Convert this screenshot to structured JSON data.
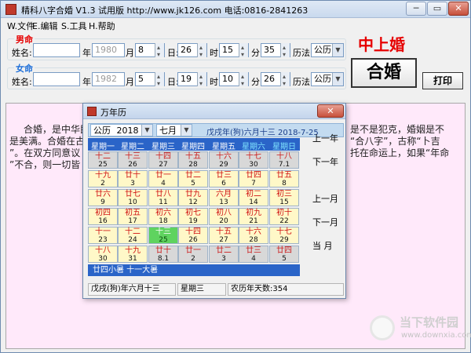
{
  "window": {
    "title": "精科八字合婚 V1.3  试用版 http://www.jk126.com  电话:0816-2841263",
    "min": "─",
    "max": "▭",
    "close": "✕"
  },
  "menu": [
    "W.文件",
    "E.编辑",
    "S.工具",
    "H.帮助"
  ],
  "male": {
    "group": "男命",
    "name_label": "姓名:",
    "name": "",
    "year_label": "年:",
    "year": "1980",
    "month_label": "月:",
    "month": "8",
    "day_label": "日:",
    "day": "26",
    "hour_label": "时:",
    "hour": "15",
    "minute_label": "分:",
    "minute": "35",
    "calendar_label": "历法:",
    "calendar": "公历"
  },
  "female": {
    "group": "女命",
    "name_label": "姓名:",
    "name": "",
    "year_label": "年:",
    "year": "1982",
    "month_label": "月:",
    "month": "5",
    "day_label": "日:",
    "day": "19",
    "hour_label": "时:",
    "hour": "10",
    "minute_label": "分:",
    "minute": "26",
    "calendar_label": "历法:",
    "calendar": "公历"
  },
  "result": "中上婚",
  "buttons": {
    "hehun": "合婚",
    "print": "打印"
  },
  "text": {
    "line1_left": "合婚，是中华民",
    "line1_right": "是不是犯克，婚姻是不",
    "line2_left": "是美满。合婚在古",
    "line2_right": "“合八字”，古称“卜吉",
    "line3_left": "”。在双方同意议",
    "line3_right": "托在命运上，如果“年命",
    "line4_left": "”不合，则一切皆"
  },
  "calendar": {
    "title": "万年历",
    "close": "✕",
    "mode": "公历",
    "year": "2018 年",
    "month": "七月",
    "info": "戊戌年(狗)六月十三  2018-7-25",
    "weekdays": [
      "星期一",
      "星期二",
      "星期三",
      "星期四",
      "星期五",
      "星期六",
      "星期日"
    ],
    "rows": [
      [
        [
          "十二",
          "25"
        ],
        [
          "十三",
          "26"
        ],
        [
          "十四",
          "27"
        ],
        [
          "十五",
          "28"
        ],
        [
          "十六",
          "29"
        ],
        [
          "十七",
          "30"
        ],
        [
          "十八",
          "7.1"
        ]
      ],
      [
        [
          "十九",
          "2"
        ],
        [
          "廿十",
          "3"
        ],
        [
          "廿一",
          "4"
        ],
        [
          "廿二",
          "5"
        ],
        [
          "廿三",
          "6"
        ],
        [
          "廿四",
          "7"
        ],
        [
          "廿五",
          "8"
        ]
      ],
      [
        [
          "廿六",
          "9"
        ],
        [
          "廿七",
          "10"
        ],
        [
          "廿八",
          "11"
        ],
        [
          "廿九",
          "12"
        ],
        [
          "六月",
          "13"
        ],
        [
          "初二",
          "14"
        ],
        [
          "初三",
          "15"
        ]
      ],
      [
        [
          "初四",
          "16"
        ],
        [
          "初五",
          "17"
        ],
        [
          "初六",
          "18"
        ],
        [
          "初七",
          "19"
        ],
        [
          "初八",
          "20"
        ],
        [
          "初九",
          "21"
        ],
        [
          "初十",
          "22"
        ]
      ],
      [
        [
          "十一",
          "23"
        ],
        [
          "十二",
          "24"
        ],
        [
          "十三",
          "25"
        ],
        [
          "十四",
          "26"
        ],
        [
          "十五",
          "27"
        ],
        [
          "十六",
          "28"
        ],
        [
          "十七",
          "29"
        ]
      ],
      [
        [
          "十八",
          "30"
        ],
        [
          "十九",
          "31"
        ],
        [
          "廿十",
          "8.1"
        ],
        [
          "廿一",
          "2"
        ],
        [
          "廿二",
          "3"
        ],
        [
          "廿三",
          "4"
        ],
        [
          "廿四",
          "5"
        ]
      ]
    ],
    "solar_terms": "廿四小暑   十一大暑",
    "nav": [
      "上一年",
      "下一年",
      "上一月",
      "下一月",
      "当  月"
    ],
    "status": [
      "戊戌(狗)年六月十三",
      "星期三",
      "农历年天数:354"
    ]
  },
  "watermark": {
    "text": "当下软件园",
    "url": "www.downxia.com"
  }
}
